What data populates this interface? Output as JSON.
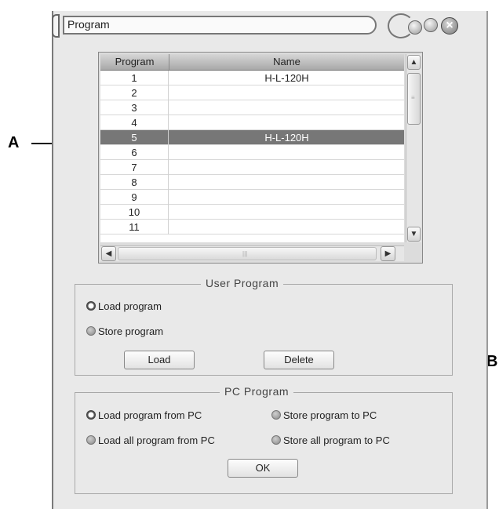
{
  "window": {
    "title": "Program"
  },
  "table": {
    "headers": {
      "program": "Program",
      "name": "Name"
    },
    "rows": [
      {
        "num": "1",
        "name": "H-L-120H",
        "selected": false
      },
      {
        "num": "2",
        "name": "",
        "selected": false
      },
      {
        "num": "3",
        "name": "",
        "selected": false
      },
      {
        "num": "4",
        "name": "",
        "selected": false
      },
      {
        "num": "5",
        "name": "H-L-120H",
        "selected": true
      },
      {
        "num": "6",
        "name": "",
        "selected": false
      },
      {
        "num": "7",
        "name": "",
        "selected": false
      },
      {
        "num": "8",
        "name": "",
        "selected": false
      },
      {
        "num": "9",
        "name": "",
        "selected": false
      },
      {
        "num": "10",
        "name": "",
        "selected": false
      },
      {
        "num": "11",
        "name": "",
        "selected": false
      }
    ]
  },
  "user_program": {
    "title": "User Program",
    "load_program": "Load program",
    "store_program": "Store program",
    "selected": "load_program",
    "load_button": "Load",
    "delete_button": "Delete"
  },
  "pc_program": {
    "title": "PC Program",
    "load_from_pc": "Load program from PC",
    "store_to_pc": "Store program to PC",
    "load_all_from_pc": "Load all program from PC",
    "store_all_to_pc": "Store all program to PC",
    "selected": "load_from_pc",
    "ok_button": "OK"
  },
  "annotations": {
    "a": "A",
    "b": "B"
  },
  "colors": {
    "selected_row": "#777777",
    "window_bg": "#e9e9e9"
  }
}
